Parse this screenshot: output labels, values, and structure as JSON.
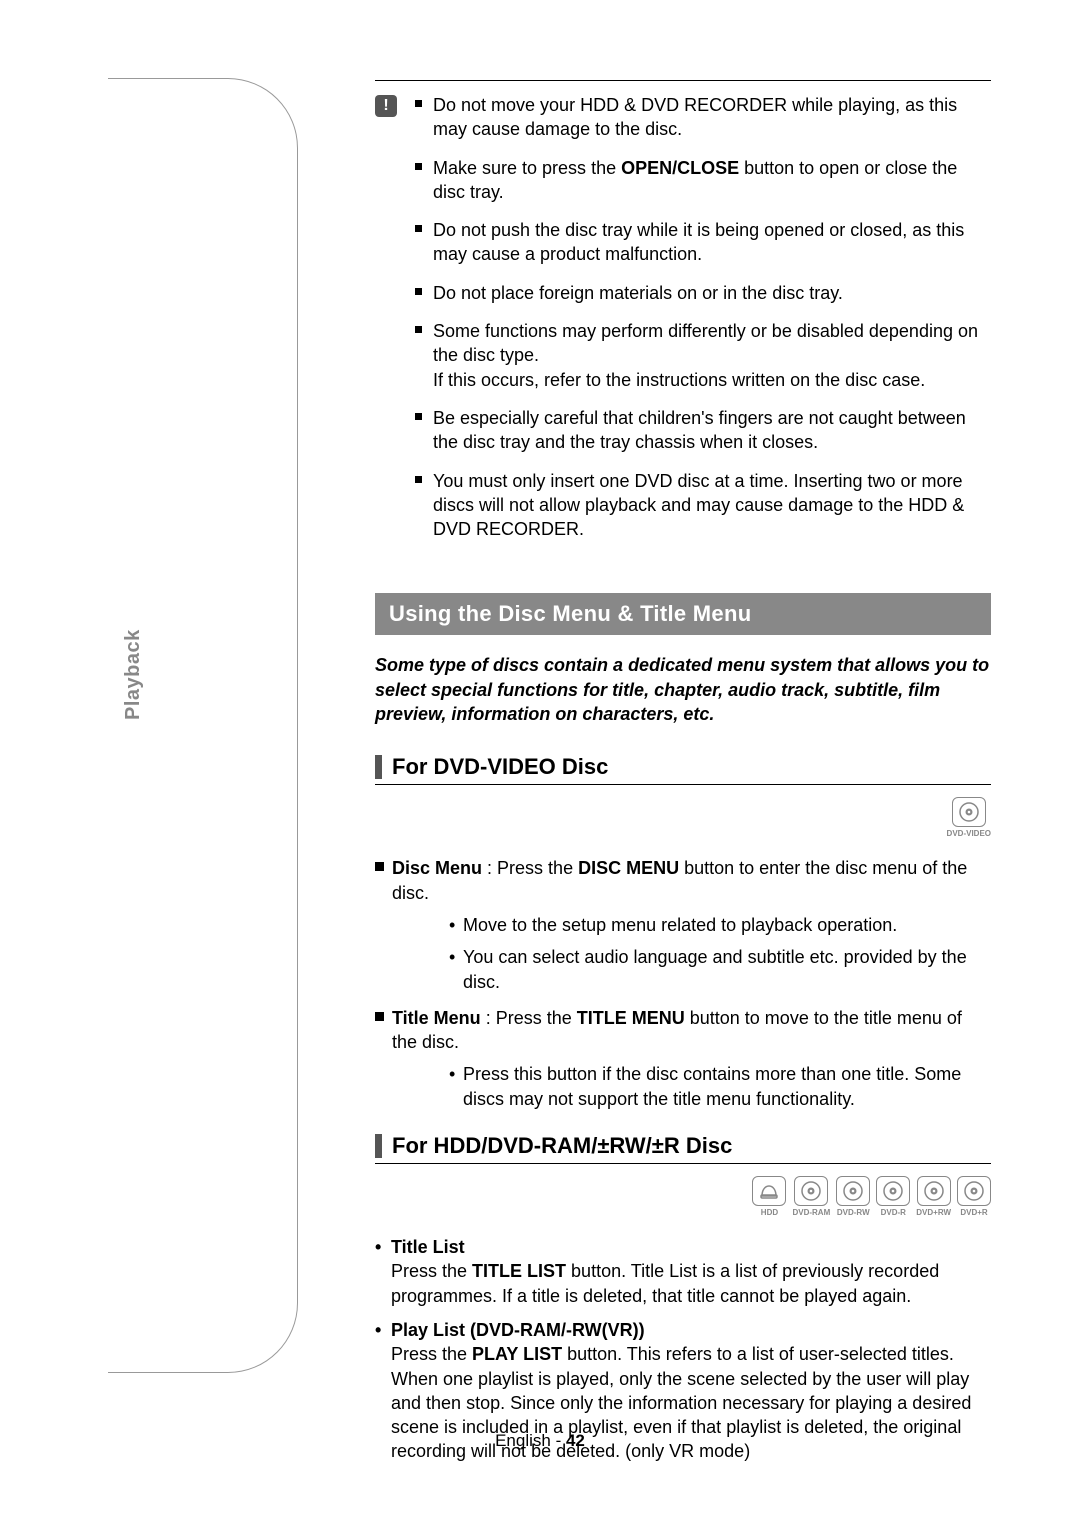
{
  "side_label": "Playback",
  "caution_icon": "!",
  "cautions": {
    "items": [
      "Do not move your HDD & DVD RECORDER while playing, as this may cause damage to the disc.",
      "<HTML>Make sure to press the <b>OPEN/CLOSE</b> button to open or close the disc tray.",
      "Do not push the disc tray while it is being opened or closed, as this may cause a product malfunction.",
      "Do not place foreign materials on or in the disc tray.",
      "<HTML>Some functions may perform differently or be disabled depending on the disc type.<br>If this occurs, refer to the instructions written on the disc case.",
      "Be especially careful that children's fingers are not caught between the disc tray and the tray chassis when it closes.",
      "You must only insert one DVD disc at a time. Inserting two or more discs will not allow playback and may cause damage to the HDD & DVD RECORDER."
    ]
  },
  "banner": "Using the Disc Menu & Title Menu",
  "intro": "Some type of discs contain a dedicated menu system that allows you to select special functions for title, chapter, audio track, subtitle, film preview, information on characters, etc.",
  "section1": {
    "title": "For DVD-VIDEO Disc",
    "icons": [
      {
        "kind": "disc",
        "label": "DVD-VIDEO"
      }
    ],
    "disc_menu": {
      "label": "Disc Menu",
      "text": ": Press the <b>DISC MENU</b> button to enter the disc menu of the disc.",
      "subs": [
        "Move to the setup menu related to playback operation.",
        "You can select audio language and subtitle etc. provided by the disc."
      ]
    },
    "title_menu": {
      "label": "Title Menu",
      "text": ": Press the <b>TITLE MENU</b> button to move to the title menu of the disc.",
      "subs": [
        "Press this button if the disc contains more than one title. Some discs may not support the title menu functionality."
      ]
    }
  },
  "section2": {
    "title": "For HDD/DVD-RAM/±RW/±R Disc",
    "icons": [
      {
        "kind": "hdd",
        "label": "HDD"
      },
      {
        "kind": "disc",
        "label": "DVD-RAM"
      },
      {
        "kind": "disc",
        "label": "DVD-RW"
      },
      {
        "kind": "disc",
        "label": "DVD-R"
      },
      {
        "kind": "disc",
        "label": "DVD+RW"
      },
      {
        "kind": "disc",
        "label": "DVD+R"
      }
    ],
    "items": [
      {
        "label": "Title List",
        "text": "Press the <b>TITLE LIST</b> button. Title List is a list of previously recorded programmes. If a title is deleted, that title cannot be played again."
      },
      {
        "label": "Play List (DVD-RAM/-RW(VR))",
        "text": "Press the <b>PLAY LIST</b> button. This refers to a list of user-selected titles. When one playlist is played, only the scene selected by the user will play and then stop. Since only the information necessary for playing a desired scene is included in a playlist, even if that playlist is deleted, the original recording will not be deleted. (only VR mode)"
      }
    ]
  },
  "footer": {
    "lang": "English",
    "page": "42"
  }
}
